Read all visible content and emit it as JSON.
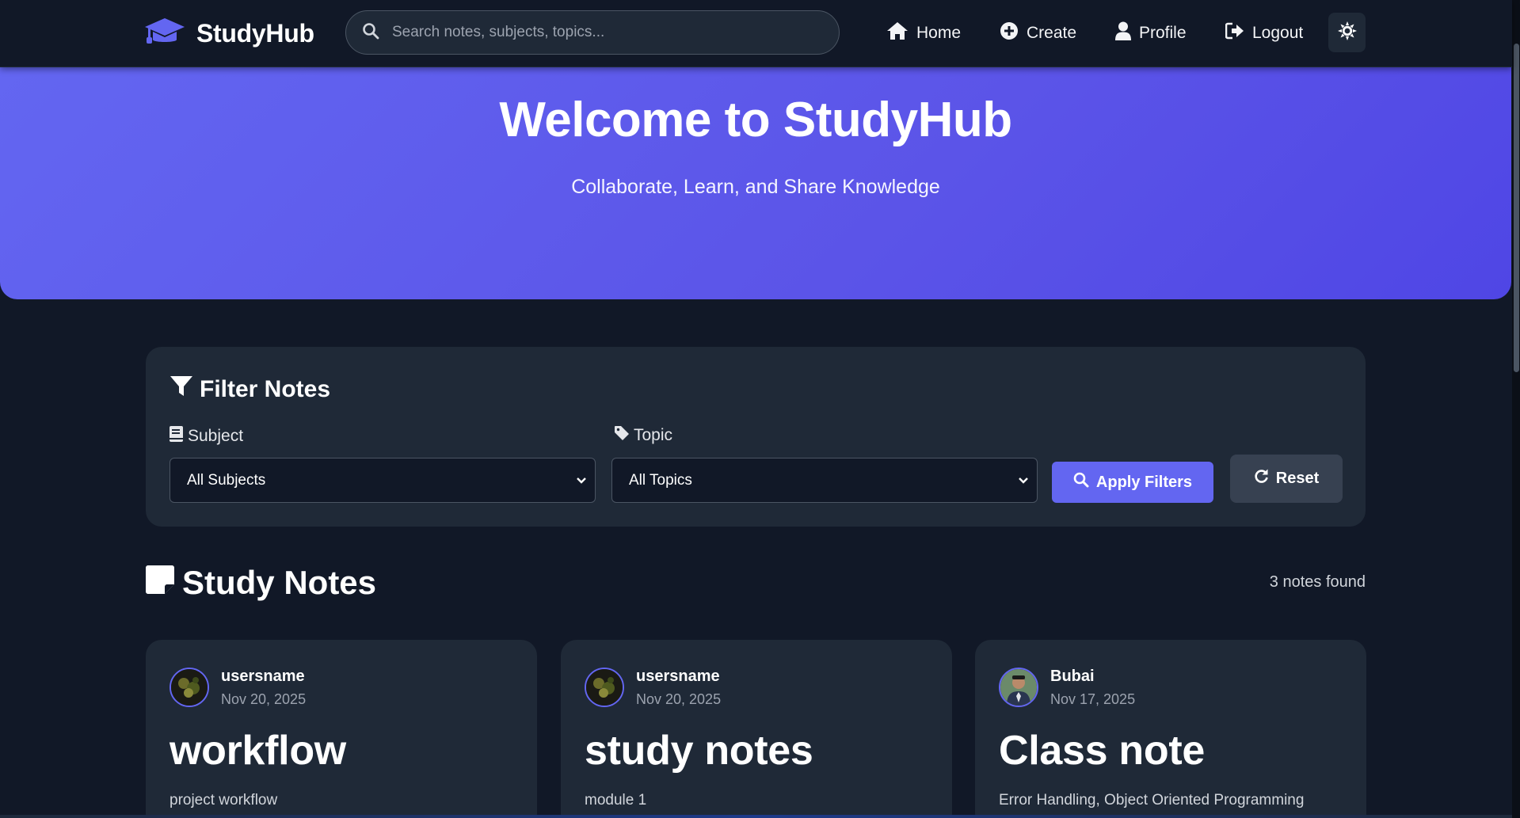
{
  "brand": {
    "name": "StudyHub",
    "icon": "graduation-cap-icon",
    "accent": "#6366f1"
  },
  "search": {
    "placeholder": "Search notes, subjects, topics...",
    "value": ""
  },
  "nav": {
    "home": "Home",
    "create": "Create",
    "profile": "Profile",
    "logout": "Logout",
    "theme_icon": "sun-icon"
  },
  "hero": {
    "title": "Welcome to StudyHub",
    "subtitle": "Collaborate, Learn, and Share Knowledge",
    "gradient_from": "#6366f1",
    "gradient_to": "#4f46e5"
  },
  "filters": {
    "title": "Filter Notes",
    "subject_label": "Subject",
    "subject_value": "All Subjects",
    "topic_label": "Topic",
    "topic_value": "All Topics",
    "apply_label": "Apply Filters",
    "reset_label": "Reset"
  },
  "notes_section": {
    "title": "Study Notes",
    "count_text": "3 notes found",
    "cards": [
      {
        "author": "usersname",
        "date": "Nov 20, 2025",
        "title": "workflow",
        "subtitle": "project workflow"
      },
      {
        "author": "usersname",
        "date": "Nov 20, 2025",
        "title": "study notes",
        "subtitle": "module 1"
      },
      {
        "author": "Bubai",
        "date": "Nov 17, 2025",
        "title": "Class note",
        "subtitle": "Error Handling, Object Oriented Programming"
      }
    ]
  }
}
